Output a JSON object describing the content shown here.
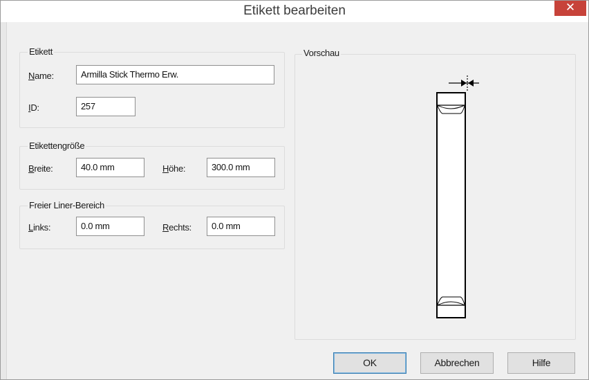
{
  "window": {
    "title": "Etikett bearbeiten",
    "close_glyph": "✕"
  },
  "etikett": {
    "legend": "Etikett",
    "name_label_u": "N",
    "name_label_rest": "ame:",
    "name_value": "Armilla Stick Thermo Erw.",
    "id_label_u": "I",
    "id_label_rest": "D:",
    "id_value": "257"
  },
  "groesse": {
    "legend": "Etikettengröße",
    "breite_label_u": "B",
    "breite_label_rest": "reite:",
    "breite_value": "40.0 mm",
    "hoehe_label_u": "H",
    "hoehe_label_rest": "öhe:",
    "hoehe_value": "300.0 mm"
  },
  "liner": {
    "legend": "Freier Liner-Bereich",
    "links_label_u": "L",
    "links_label_rest": "inks:",
    "links_value": "0.0 mm",
    "rechts_label_u": "R",
    "rechts_label_rest": "echts:",
    "rechts_value": "0.0 mm"
  },
  "vorschau": {
    "legend": "Vorschau",
    "preview_icon": "label-preview-icon"
  },
  "buttons": {
    "ok": "OK",
    "cancel": "Abbrechen",
    "help": "Hilfe"
  },
  "colors": {
    "close": "#c7433a",
    "dialog_bg": "#f0f0f0",
    "default_button_border": "#3c7fb1"
  }
}
